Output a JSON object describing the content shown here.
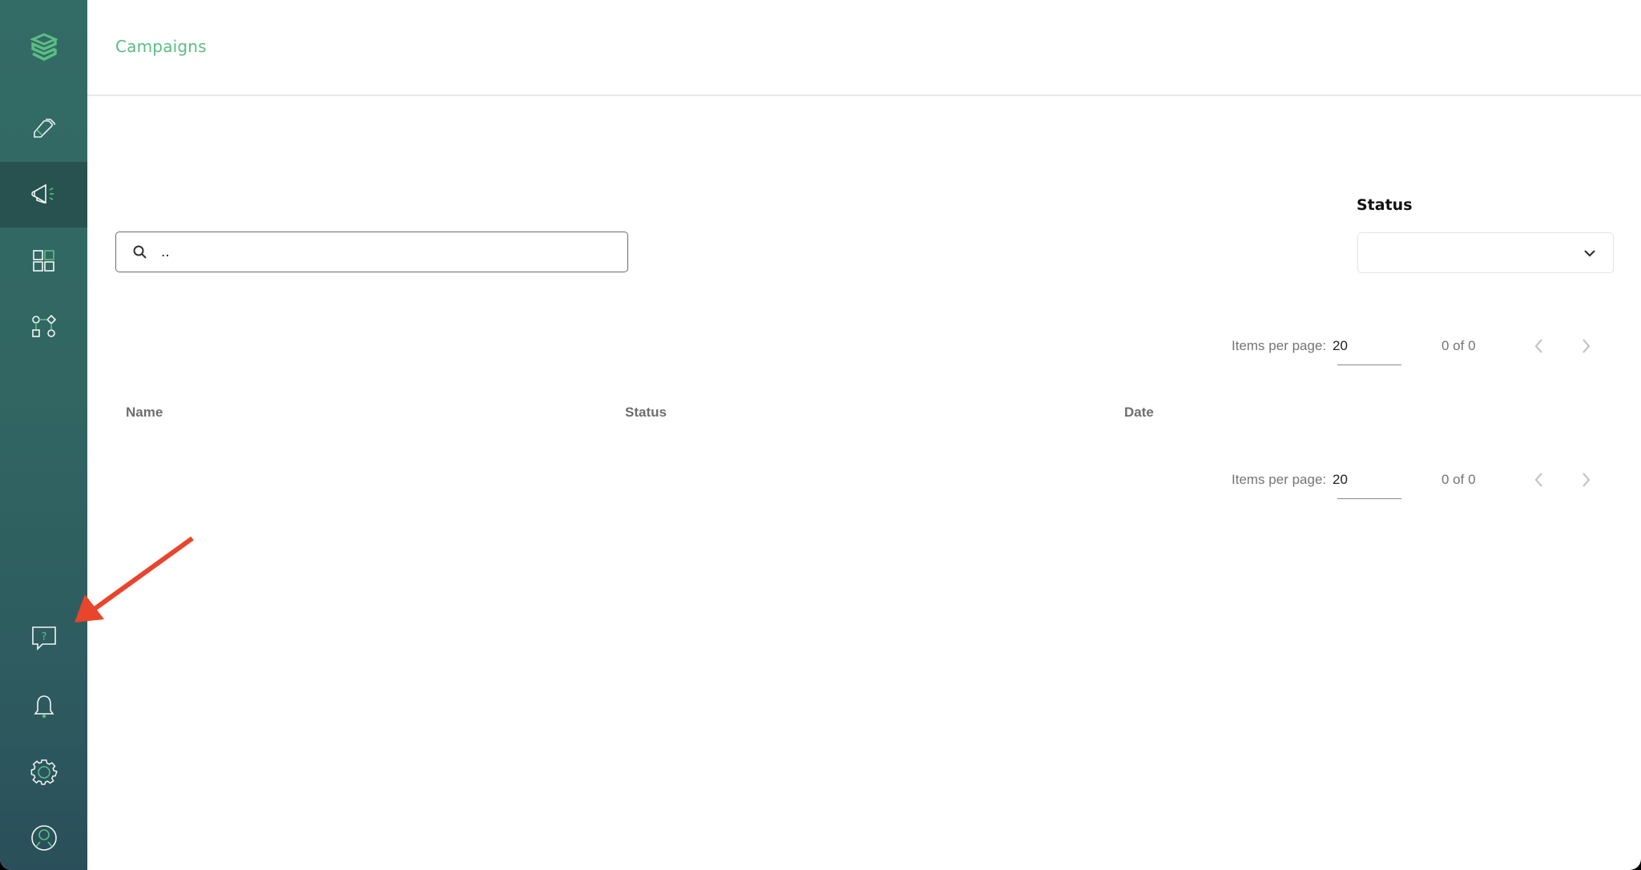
{
  "sidebar": {
    "logo_icon": "stacked-layers-logo",
    "top_items": [
      {
        "name": "tag-edit",
        "icon": "pencil-tag-icon",
        "active": false
      },
      {
        "name": "campaigns",
        "icon": "megaphone-icon",
        "active": true
      },
      {
        "name": "dashboard",
        "icon": "grid-icon",
        "active": false
      },
      {
        "name": "workflows",
        "icon": "flow-shapes-icon",
        "active": false
      }
    ],
    "bottom_items": [
      {
        "name": "help",
        "icon": "help-chat-icon"
      },
      {
        "name": "notifications",
        "icon": "bell-icon"
      },
      {
        "name": "settings",
        "icon": "gear-icon"
      },
      {
        "name": "profile",
        "icon": "user-circle-icon"
      }
    ]
  },
  "header": {
    "title": "Campaigns"
  },
  "filters": {
    "search": {
      "value": "..",
      "placeholder": ""
    },
    "status": {
      "label": "Status",
      "selected": ""
    }
  },
  "pagination_top": {
    "items_per_page_label": "Items per page:",
    "items_per_page": "20",
    "range": "0 of 0"
  },
  "pagination_bottom": {
    "items_per_page_label": "Items per page:",
    "items_per_page": "20",
    "range": "0 of 0"
  },
  "table": {
    "columns": [
      "Name",
      "Status",
      "Date"
    ],
    "rows": []
  },
  "colors": {
    "brand_green": "#5bbd83",
    "sidebar": "#336b66",
    "sidebar_active": "#285250",
    "annotation_arrow": "#e8452c"
  }
}
